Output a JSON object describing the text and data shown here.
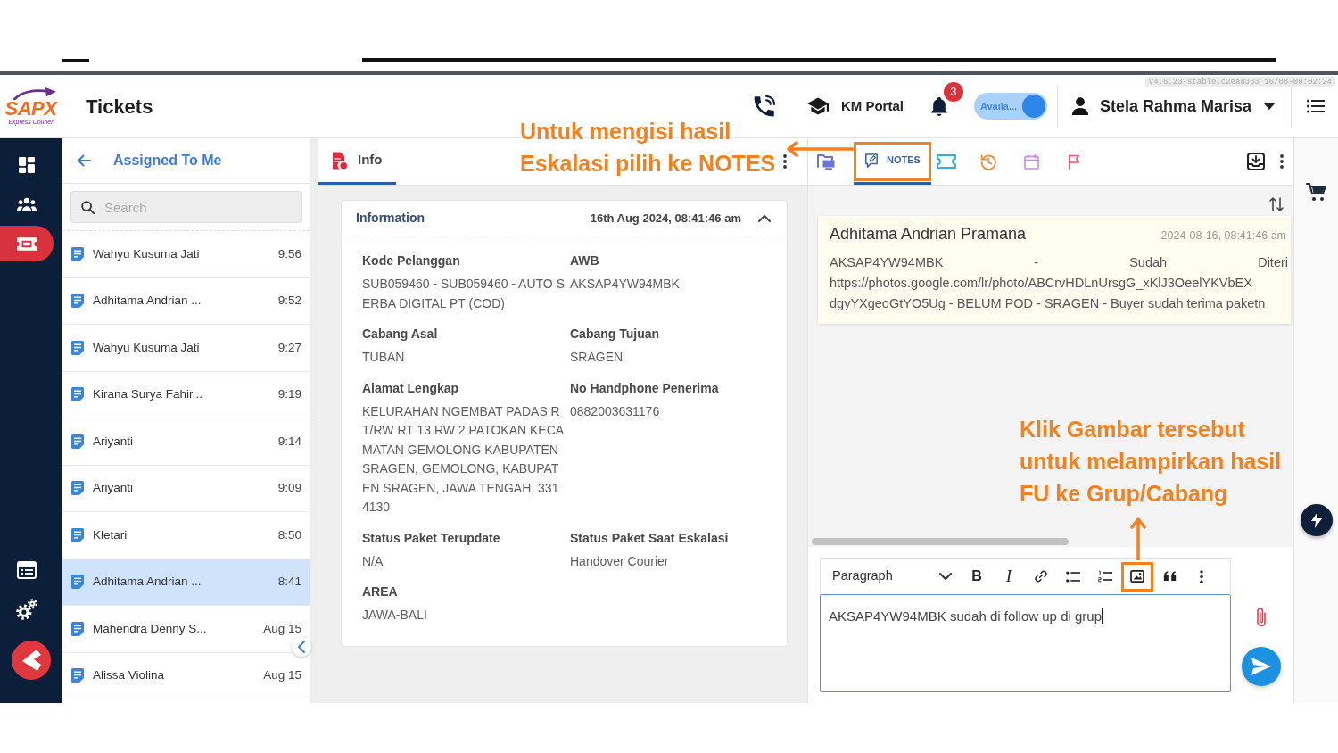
{
  "header": {
    "logo": {
      "text": "SAPX",
      "tagline": "Express Courier"
    },
    "title": "Tickets",
    "portal": "KM Portal",
    "notification_count": "3",
    "status_toggle": {
      "label": "Availa...",
      "on": true
    },
    "user": "Stela Rahma Marisa",
    "version": "v4.6.23-stable.c2ea8333 16/08-09:02:24"
  },
  "sidebar": {
    "top_items": [
      {
        "kind": "dashboard",
        "selected": false
      },
      {
        "kind": "team",
        "selected": false
      },
      {
        "kind": "tickets",
        "selected": true
      }
    ],
    "bottom_items": [
      {
        "kind": "report",
        "selected": false
      },
      {
        "kind": "settings",
        "selected": false
      }
    ]
  },
  "ticket_list": {
    "title": "Assigned To Me",
    "search": {
      "placeholder": "Search"
    },
    "items": [
      {
        "name": "Wahyu Kusuma Jati",
        "time": "9:56",
        "selected": false
      },
      {
        "name": "Adhitama Andrian ...",
        "time": "9:52",
        "selected": false
      },
      {
        "name": "Wahyu Kusuma Jati",
        "time": "9:27",
        "selected": false
      },
      {
        "name": "Kirana Surya Fahir...",
        "time": "9:19",
        "selected": false
      },
      {
        "name": "Ariyanti",
        "time": "9:14",
        "selected": false
      },
      {
        "name": "Ariyanti",
        "time": "9:09",
        "selected": false
      },
      {
        "name": "Kletari",
        "time": "8:50",
        "selected": false
      },
      {
        "name": "Adhitama Andrian ...",
        "time": "8:41",
        "selected": true
      },
      {
        "name": "Mahendra Denny S...",
        "time": "Aug 15",
        "selected": false
      },
      {
        "name": "Alissa Violina",
        "time": "Aug 15",
        "selected": false
      }
    ]
  },
  "info_panel": {
    "tabs": [
      {
        "label": "Info",
        "selected": true
      }
    ],
    "card": {
      "title": "Information",
      "timestamp": "16th Aug 2024, 08:41:46 am",
      "expanded": true,
      "fields": [
        {
          "label": "Kode Pelanggan",
          "value": "SUB059460 - SUB059460 - AUTO SERBA DIGITAL PT (COD)"
        },
        {
          "label": "AWB",
          "value": "AKSAP4YW94MBK"
        },
        {
          "label": "Cabang Asal",
          "value": "TUBAN"
        },
        {
          "label": "Cabang Tujuan",
          "value": "SRAGEN"
        },
        {
          "label": "Alamat Lengkap",
          "value": "KELURAHAN NGEMBAT PADAS RT/RW RT 13 RW 2 PATOKAN KECAMATAN GEMOLONG KABUPATEN SRAGEN, GEMOLONG, KABUPATEN SRAGEN, JAWA TENGAH, 3314130"
        },
        {
          "label": "No Handphone Penerima",
          "value": "0882003631176"
        },
        {
          "label": "Status Paket Terupdate",
          "value": "N/A"
        },
        {
          "label": "Status Paket Saat Eskalasi",
          "value": "Handover Courier"
        },
        {
          "label": "AREA",
          "value": "JAWA-BALI"
        }
      ]
    }
  },
  "notes_panel": {
    "tabs": [
      {
        "kind": "files",
        "selected": false,
        "highlighted": false,
        "color": "#6a74d6"
      },
      {
        "kind": "notes",
        "label": "NOTES",
        "selected": true,
        "highlighted": true,
        "color": "#3d64a8"
      },
      {
        "kind": "ticket",
        "selected": false,
        "highlighted": false,
        "color": "#2bb3d1"
      },
      {
        "kind": "history",
        "selected": false,
        "highlighted": false,
        "color": "#f08c3a"
      },
      {
        "kind": "calendar",
        "selected": false,
        "highlighted": false,
        "color": "#c78ce6"
      },
      {
        "kind": "flag",
        "selected": false,
        "highlighted": false,
        "color": "#e8566b"
      }
    ],
    "notes": [
      {
        "author": "Adhitama Andrian Pramana",
        "time": "2024-08-16, 08:41:46 am",
        "lines": [
          "AKSAP4YW94MBK - Sudah Diteri",
          "https://photos.google.com/lr/photo/ABCrvHDLnUrsgG_xKlJ3OeelYKVbEX",
          "dgyYXgeoGtYO5Ug - BELUM POD - SRAGEN - Buyer sudah terima paketn"
        ]
      }
    ],
    "editor": {
      "format": "Paragraph",
      "tools": [
        {
          "kind": "bold",
          "label": "B",
          "highlighted": false
        },
        {
          "kind": "italic",
          "label": "I",
          "highlighted": false
        },
        {
          "kind": "link",
          "highlighted": false
        },
        {
          "kind": "bullets",
          "highlighted": false
        },
        {
          "kind": "numbers",
          "highlighted": false
        },
        {
          "kind": "image",
          "highlighted": true
        },
        {
          "kind": "quote",
          "highlighted": false
        },
        {
          "kind": "more",
          "highlighted": false
        }
      ],
      "value": "AKSAP4YW94MBK sudah di follow up di grup",
      "focused": true
    }
  },
  "annotations": [
    {
      "lines": [
        "Untuk mengisi hasil",
        "Eskalasi pilih ke NOTES"
      ]
    },
    {
      "lines": [
        "Klik Gambar tersebut",
        "untuk melampirkan hasil",
        "FU ke Grup/Cabang"
      ]
    }
  ]
}
